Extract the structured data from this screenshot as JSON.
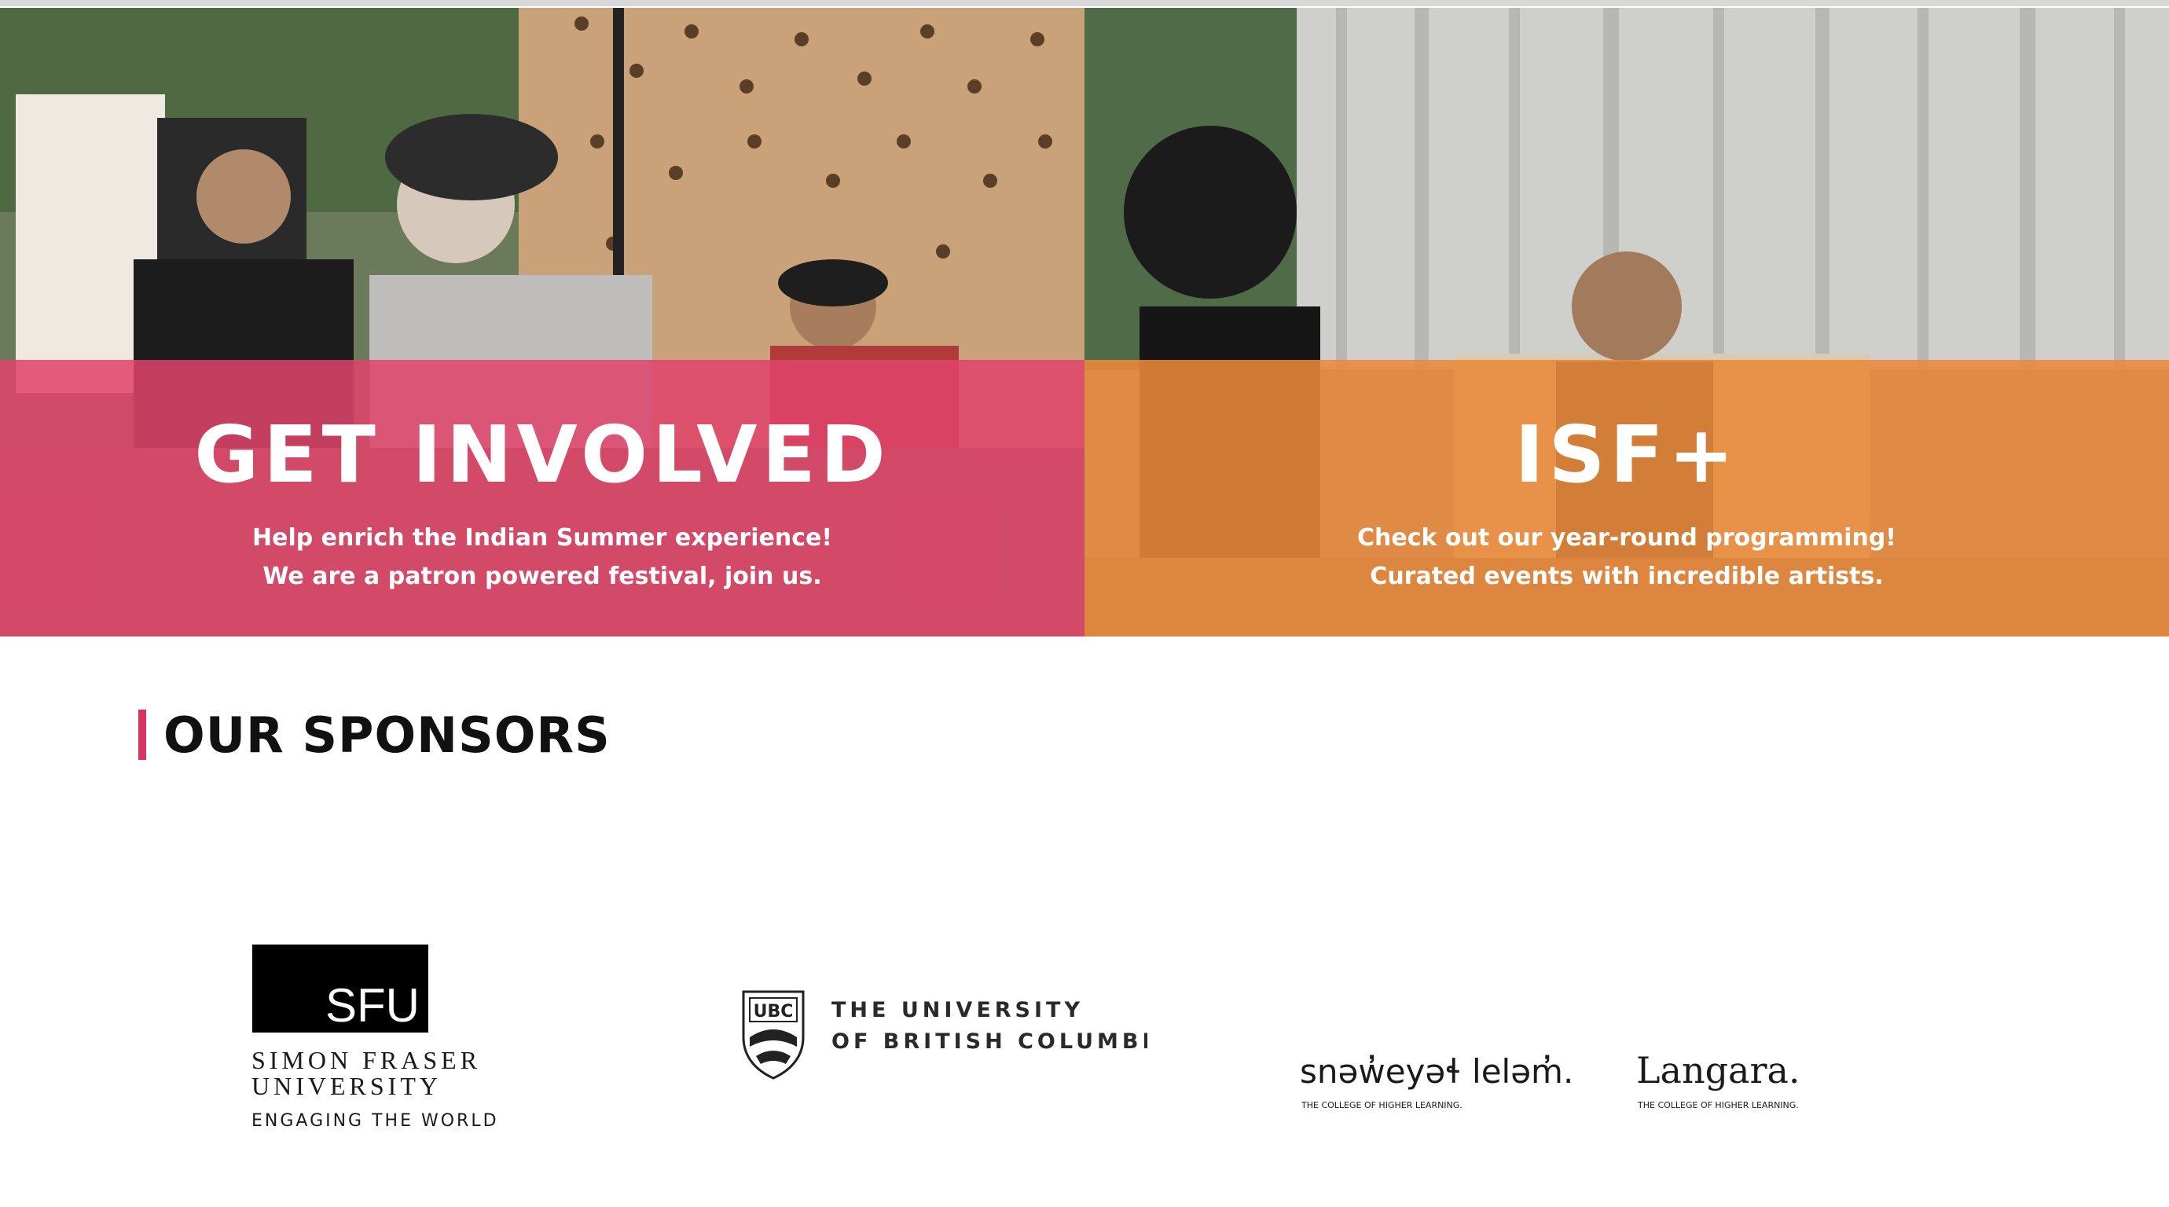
{
  "tiles": [
    {
      "title": "GET INVOLVED",
      "line1": "Help enrich the Indian Summer experience!",
      "line2": "We are a patron powered festival, join us.",
      "overlay_color": "#e0436a"
    },
    {
      "title": "ISF+",
      "line1": "Check out our year-round programming!",
      "line2": "Curated events with incredible artists.",
      "overlay_color": "#e9893a"
    }
  ],
  "sponsors": {
    "heading": "OUR SPONSORS",
    "accent_color": "#d8345f",
    "sfu": {
      "mark": "SFU",
      "line1": "SIMON FRASER",
      "line2": "UNIVERSITY",
      "line3": "ENGAGING THE WORLD"
    },
    "ubc": {
      "mark": "UBC",
      "line1": "THE UNIVERSITY",
      "line2": "OF BRITISH COLUMBIA"
    },
    "langara_native": {
      "name": "snəw̓eyəɬ leləm̓.",
      "tagline": "THE COLLEGE OF HIGHER LEARNING."
    },
    "langara": {
      "name": "Langara.",
      "tagline": "THE COLLEGE OF HIGHER LEARNING."
    }
  }
}
